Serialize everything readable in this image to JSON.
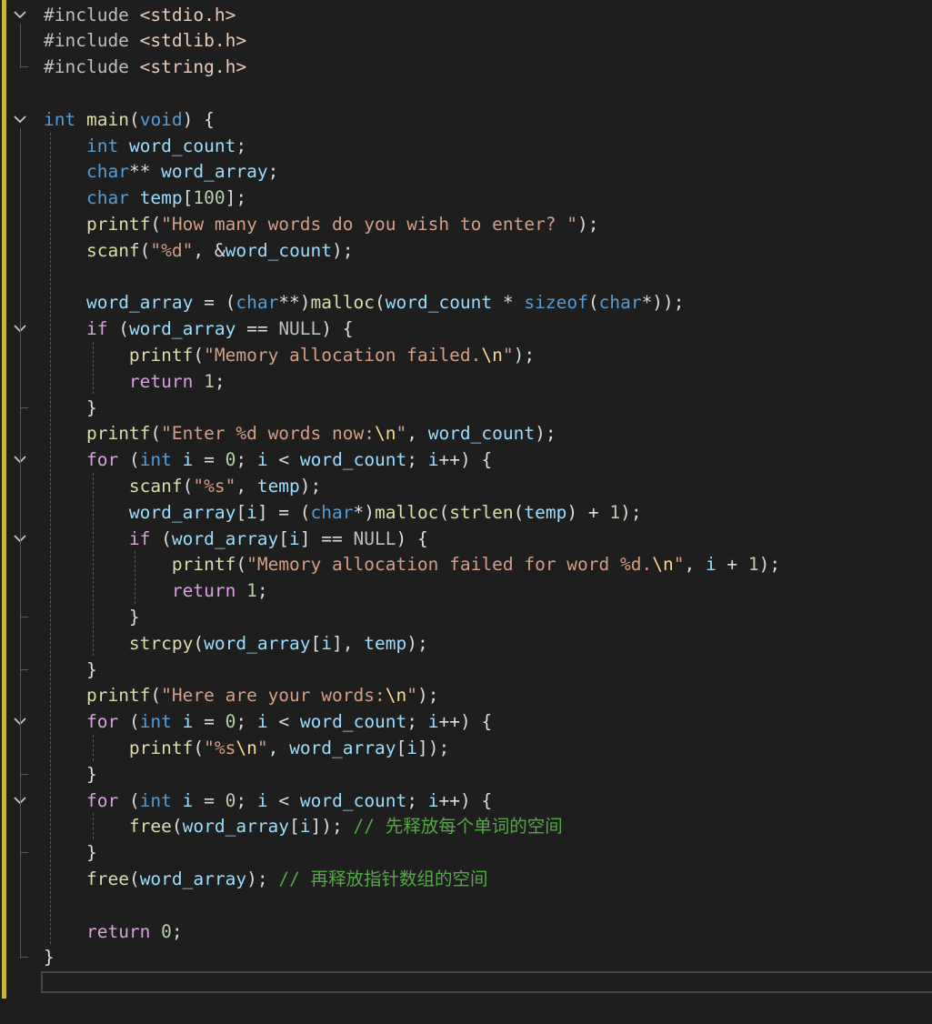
{
  "editor": {
    "language": "C",
    "colors": {
      "background": "#1e1e1e",
      "default": "#dcdcdc",
      "keyword": "#569cd6",
      "control": "#d8a0df",
      "function": "#dcdcaa",
      "variable": "#9cdcfe",
      "string": "#d69d85",
      "escape": "#ffd68f",
      "number": "#b5cea8",
      "comment": "#57a64a",
      "macro": "#bebebe",
      "include_path": "#e8c9bb",
      "change_marker": "#c8b43c"
    },
    "fold_icon": "chevron-down-icon",
    "lines": [
      [
        [
          "#include ",
          "macro"
        ],
        [
          "<stdio.h>",
          "include_path"
        ]
      ],
      [
        [
          "#include ",
          "macro"
        ],
        [
          "<stdlib.h>",
          "include_path"
        ]
      ],
      [
        [
          "#include ",
          "macro"
        ],
        [
          "<string.h>",
          "include_path"
        ]
      ],
      [],
      [
        [
          "int",
          "keyword"
        ],
        [
          " "
        ],
        [
          "main",
          "function"
        ],
        [
          "("
        ],
        [
          "void",
          "keyword"
        ],
        [
          ") {"
        ]
      ],
      [
        [
          "    "
        ],
        [
          "int",
          "keyword"
        ],
        [
          " "
        ],
        [
          "word_count",
          "variable"
        ],
        [
          ";"
        ]
      ],
      [
        [
          "    "
        ],
        [
          "char",
          "keyword"
        ],
        [
          "** "
        ],
        [
          "word_array",
          "variable"
        ],
        [
          ";"
        ]
      ],
      [
        [
          "    "
        ],
        [
          "char",
          "keyword"
        ],
        [
          " "
        ],
        [
          "temp",
          "variable"
        ],
        [
          "["
        ],
        [
          "100",
          "number"
        ],
        [
          "];"
        ]
      ],
      [
        [
          "    "
        ],
        [
          "printf",
          "function"
        ],
        [
          "("
        ],
        [
          "\"How many words do you wish to enter? \"",
          "string"
        ],
        [
          ");"
        ]
      ],
      [
        [
          "    "
        ],
        [
          "scanf",
          "function"
        ],
        [
          "("
        ],
        [
          "\"%d\"",
          "string"
        ],
        [
          ", &"
        ],
        [
          "word_count",
          "variable"
        ],
        [
          ");"
        ]
      ],
      [],
      [
        [
          "    "
        ],
        [
          "word_array",
          "variable"
        ],
        [
          " = ("
        ],
        [
          "char",
          "keyword"
        ],
        [
          "**)"
        ],
        [
          "malloc",
          "function"
        ],
        [
          "("
        ],
        [
          "word_count",
          "variable"
        ],
        [
          " * "
        ],
        [
          "sizeof",
          "keyword"
        ],
        [
          "("
        ],
        [
          "char",
          "keyword"
        ],
        [
          "*));"
        ]
      ],
      [
        [
          "    "
        ],
        [
          "if",
          "control"
        ],
        [
          " ("
        ],
        [
          "word_array",
          "variable"
        ],
        [
          " == "
        ],
        [
          "NULL",
          "macro"
        ],
        [
          ") {"
        ]
      ],
      [
        [
          "        "
        ],
        [
          "printf",
          "function"
        ],
        [
          "("
        ],
        [
          "\"Memory allocation failed.",
          "string"
        ],
        [
          "\\n",
          "escape"
        ],
        [
          "\"",
          "string"
        ],
        [
          ");"
        ]
      ],
      [
        [
          "        "
        ],
        [
          "return",
          "control"
        ],
        [
          " "
        ],
        [
          "1",
          "number"
        ],
        [
          ";"
        ]
      ],
      [
        [
          "    }"
        ]
      ],
      [
        [
          "    "
        ],
        [
          "printf",
          "function"
        ],
        [
          "("
        ],
        [
          "\"Enter %d words now:",
          "string"
        ],
        [
          "\\n",
          "escape"
        ],
        [
          "\"",
          "string"
        ],
        [
          ", "
        ],
        [
          "word_count",
          "variable"
        ],
        [
          ");"
        ]
      ],
      [
        [
          "    "
        ],
        [
          "for",
          "control"
        ],
        [
          " ("
        ],
        [
          "int",
          "keyword"
        ],
        [
          " "
        ],
        [
          "i",
          "variable"
        ],
        [
          " = "
        ],
        [
          "0",
          "number"
        ],
        [
          "; "
        ],
        [
          "i",
          "variable"
        ],
        [
          " < "
        ],
        [
          "word_count",
          "variable"
        ],
        [
          "; "
        ],
        [
          "i",
          "variable"
        ],
        [
          "++) {"
        ]
      ],
      [
        [
          "        "
        ],
        [
          "scanf",
          "function"
        ],
        [
          "("
        ],
        [
          "\"%s\"",
          "string"
        ],
        [
          ", "
        ],
        [
          "temp",
          "variable"
        ],
        [
          ");"
        ]
      ],
      [
        [
          "        "
        ],
        [
          "word_array",
          "variable"
        ],
        [
          "["
        ],
        [
          "i",
          "variable"
        ],
        [
          "] = ("
        ],
        [
          "char",
          "keyword"
        ],
        [
          "*)"
        ],
        [
          "malloc",
          "function"
        ],
        [
          "("
        ],
        [
          "strlen",
          "function"
        ],
        [
          "("
        ],
        [
          "temp",
          "variable"
        ],
        [
          ") + "
        ],
        [
          "1",
          "number"
        ],
        [
          ");"
        ]
      ],
      [
        [
          "        "
        ],
        [
          "if",
          "control"
        ],
        [
          " ("
        ],
        [
          "word_array",
          "variable"
        ],
        [
          "["
        ],
        [
          "i",
          "variable"
        ],
        [
          "] == "
        ],
        [
          "NULL",
          "macro"
        ],
        [
          ") {"
        ]
      ],
      [
        [
          "            "
        ],
        [
          "printf",
          "function"
        ],
        [
          "("
        ],
        [
          "\"Memory allocation failed for word %d.",
          "string"
        ],
        [
          "\\n",
          "escape"
        ],
        [
          "\"",
          "string"
        ],
        [
          ", "
        ],
        [
          "i",
          "variable"
        ],
        [
          " + "
        ],
        [
          "1",
          "number"
        ],
        [
          ");"
        ]
      ],
      [
        [
          "            "
        ],
        [
          "return",
          "control"
        ],
        [
          " "
        ],
        [
          "1",
          "number"
        ],
        [
          ";"
        ]
      ],
      [
        [
          "        }"
        ]
      ],
      [
        [
          "        "
        ],
        [
          "strcpy",
          "function"
        ],
        [
          "("
        ],
        [
          "word_array",
          "variable"
        ],
        [
          "["
        ],
        [
          "i",
          "variable"
        ],
        [
          "], "
        ],
        [
          "temp",
          "variable"
        ],
        [
          ");"
        ]
      ],
      [
        [
          "    }"
        ]
      ],
      [
        [
          "    "
        ],
        [
          "printf",
          "function"
        ],
        [
          "("
        ],
        [
          "\"Here are your words:",
          "string"
        ],
        [
          "\\n",
          "escape"
        ],
        [
          "\"",
          "string"
        ],
        [
          ");"
        ]
      ],
      [
        [
          "    "
        ],
        [
          "for",
          "control"
        ],
        [
          " ("
        ],
        [
          "int",
          "keyword"
        ],
        [
          " "
        ],
        [
          "i",
          "variable"
        ],
        [
          " = "
        ],
        [
          "0",
          "number"
        ],
        [
          "; "
        ],
        [
          "i",
          "variable"
        ],
        [
          " < "
        ],
        [
          "word_count",
          "variable"
        ],
        [
          "; "
        ],
        [
          "i",
          "variable"
        ],
        [
          "++) {"
        ]
      ],
      [
        [
          "        "
        ],
        [
          "printf",
          "function"
        ],
        [
          "("
        ],
        [
          "\"%s",
          "string"
        ],
        [
          "\\n",
          "escape"
        ],
        [
          "\"",
          "string"
        ],
        [
          ", "
        ],
        [
          "word_array",
          "variable"
        ],
        [
          "["
        ],
        [
          "i",
          "variable"
        ],
        [
          "]);"
        ]
      ],
      [
        [
          "    }"
        ]
      ],
      [
        [
          "    "
        ],
        [
          "for",
          "control"
        ],
        [
          " ("
        ],
        [
          "int",
          "keyword"
        ],
        [
          " "
        ],
        [
          "i",
          "variable"
        ],
        [
          " = "
        ],
        [
          "0",
          "number"
        ],
        [
          "; "
        ],
        [
          "i",
          "variable"
        ],
        [
          " < "
        ],
        [
          "word_count",
          "variable"
        ],
        [
          "; "
        ],
        [
          "i",
          "variable"
        ],
        [
          "++) {"
        ]
      ],
      [
        [
          "        "
        ],
        [
          "free",
          "function"
        ],
        [
          "("
        ],
        [
          "word_array",
          "variable"
        ],
        [
          "["
        ],
        [
          "i",
          "variable"
        ],
        [
          "]); "
        ],
        [
          "// 先释放每个单词的空间",
          "comment"
        ]
      ],
      [
        [
          "    }"
        ]
      ],
      [
        [
          "    "
        ],
        [
          "free",
          "function"
        ],
        [
          "("
        ],
        [
          "word_array",
          "variable"
        ],
        [
          "); "
        ],
        [
          "// 再释放指针数组的空间",
          "comment"
        ]
      ],
      [],
      [
        [
          "    "
        ],
        [
          "return",
          "control"
        ],
        [
          " "
        ],
        [
          "0",
          "number"
        ],
        [
          ";"
        ]
      ],
      [
        [
          "}"
        ]
      ]
    ]
  }
}
